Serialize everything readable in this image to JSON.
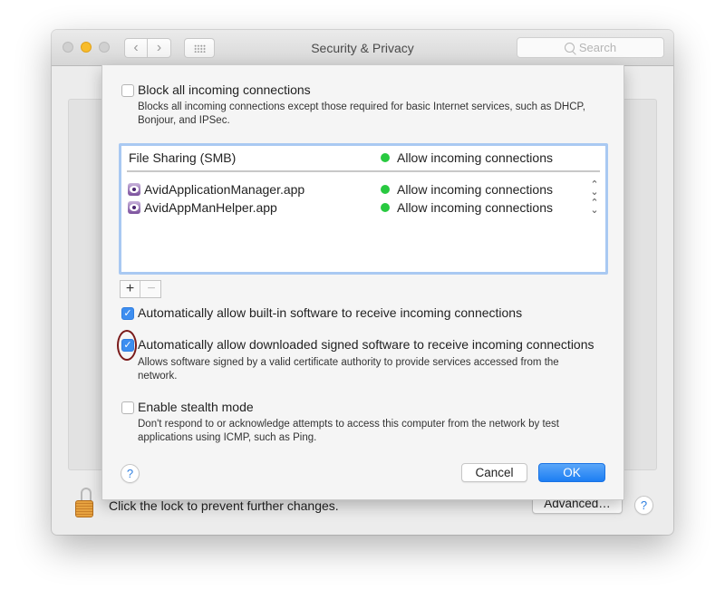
{
  "window": {
    "title": "Security & Privacy",
    "search_placeholder": "Search",
    "nav": {
      "back": "‹",
      "forward": "›"
    }
  },
  "footer": {
    "lock_text": "Click the lock to prevent further changes.",
    "advanced_label": "Advanced…",
    "help_label": "?"
  },
  "sheet": {
    "block_all": {
      "label": "Block all incoming connections",
      "checked": false,
      "description": "Blocks all incoming connections except those required for basic Internet services,  such as DHCP, Bonjour, and IPSec."
    },
    "list": {
      "service_row": {
        "name": "File Sharing (SMB)",
        "status": "Allow incoming connections"
      },
      "apps": [
        {
          "name": "AvidApplicationManager.app",
          "status": "Allow incoming connections"
        },
        {
          "name": "AvidAppManHelper.app",
          "status": "Allow incoming connections"
        }
      ],
      "status_color": "#28c940",
      "stepper_glyph": "⌃⌄"
    },
    "add_label": "+",
    "remove_label": "−",
    "auto_builtin": {
      "label": "Automatically allow built-in software to receive incoming connections",
      "checked": true
    },
    "auto_signed": {
      "label": "Automatically allow downloaded signed software to receive incoming connections",
      "checked": true,
      "description": "Allows software signed by a valid certificate authority to provide services accessed from the network."
    },
    "stealth": {
      "label": "Enable stealth mode",
      "checked": false,
      "description": "Don't respond to or acknowledge attempts to access this computer from the network by test applications using ICMP, such as Ping."
    },
    "help_label": "?",
    "cancel_label": "Cancel",
    "ok_label": "OK",
    "check_glyph": "✓"
  },
  "colors": {
    "accent": "#3d8ef0",
    "ok_button": "#1d7ef3",
    "highlight_ring": "#7a1a1a"
  }
}
